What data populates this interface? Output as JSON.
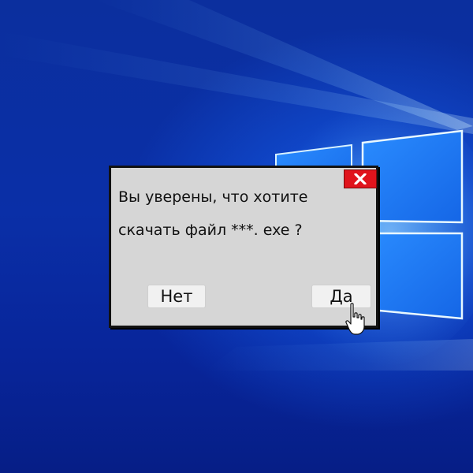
{
  "dialog": {
    "message_line1": "Вы уверены, что хотите",
    "message_line2": "скачать файл ***. exe ?",
    "close_icon": "close-icon",
    "no_label": "Нет",
    "yes_label": "Да"
  },
  "colors": {
    "desktop_blue": "#0a2fa7",
    "dialog_bg": "#d6d6d6",
    "close_red": "#e0141c",
    "button_bg": "#f1f1f1"
  },
  "cursor": {
    "icon": "hand-pointer-icon"
  }
}
